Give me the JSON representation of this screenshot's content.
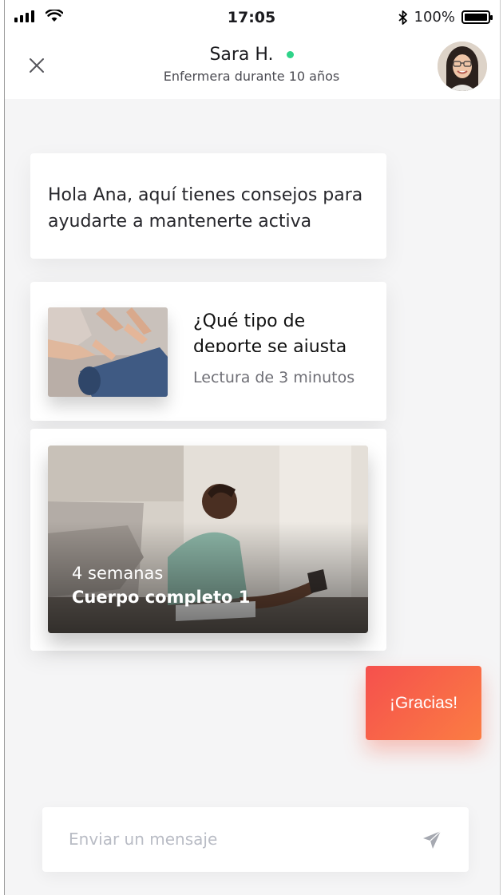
{
  "status_bar": {
    "time": "17:05",
    "battery": "100%",
    "battery_level": 1.0,
    "icons": [
      "signal-icon",
      "wifi-icon",
      "bluetooth-icon",
      "battery-icon"
    ]
  },
  "header": {
    "contact_name": "Sara H.",
    "contact_role": "Enfermera durante 10 años",
    "online": true,
    "online_color": "#2fd389",
    "close_icon": "close-icon",
    "avatar_icon": "avatar"
  },
  "messages": {
    "greeting": "Hola Ana, aquí tienes consejos para ayudarte a mantenerte activa"
  },
  "article_card": {
    "title": "¿Qué tipo de deporte se ajusta",
    "meta": "Lectura de 3 minutos",
    "image_icon": "yoga-mat-photo"
  },
  "program_card": {
    "weeks": "4 semanas",
    "title": "Cuerpo completo 1",
    "image_icon": "stretching-woman-photo"
  },
  "quick_reply": {
    "label": "¡Gracias!",
    "gradient_start": "#f5504d",
    "gradient_end": "#fb7d43"
  },
  "composer": {
    "placeholder": "Enviar un mensaje",
    "value": "",
    "send_icon": "send-icon"
  }
}
